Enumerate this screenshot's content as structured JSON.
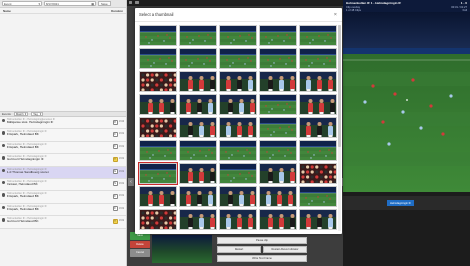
{
  "filterbar": {
    "event_dropdown": "Event",
    "date_value": "8/17/2021",
    "go_button": "Save"
  },
  "left_panel": {
    "col_header_left": "Name",
    "col_header_right": "Duration",
    "toolbar": {
      "label": "Events",
      "select_a": "Match",
      "select_b": "Tag"
    },
    "events": [
      {
        "meta": "Holmenkollen IF • Helmdagningtjenesten IF",
        "title": "Målsjanse skot. Helmdagningin IF",
        "badge": "8",
        "badge_color": "white",
        "num": "3:34",
        "selected": false
      },
      {
        "meta": "Holmenkollen IF • Helmdagningin IF",
        "title": "Frispark, Helmdaud BK",
        "badge": "F",
        "badge_color": "white",
        "num": "3:31",
        "selected": false
      },
      {
        "meta": "Holmenkollen IF • Helmdagningin IF",
        "title": "Frispark, Helmdaud BK",
        "badge": "F",
        "badge_color": "white",
        "num": "3:31",
        "selected": false
      },
      {
        "meta": "Holmenkollen IF • Helmdagningin IF",
        "title": "Gult kort Helmdagningin IF",
        "badge": "Y",
        "badge_color": "yellow",
        "num": "3:31",
        "selected": false
      },
      {
        "meta": "Holmenkollen IF • Helmdagningin IF",
        "title": "1-0 Thomas Sandboerg scoret",
        "badge": "G",
        "badge_color": "white",
        "num": "3:31",
        "selected": true
      },
      {
        "meta": "Holmenkollen IF • Helmdagningin IF",
        "title": "Innkast, Helmdaud BK",
        "badge": "S",
        "badge_color": "white",
        "num": "3:31",
        "selected": false
      },
      {
        "meta": "Holmenkollen IF • Helmdagningin IF",
        "title": "Frispark, Helmdaud BK",
        "badge": "F",
        "badge_color": "white",
        "num": "3:31",
        "selected": false
      },
      {
        "meta": "Holmenkollen IF • Helmdagningin IF",
        "title": "Frispark, Helmdaud BK",
        "badge": "F",
        "badge_color": "white",
        "num": "3:31",
        "selected": false
      },
      {
        "meta": "Holmenkollen IF • Helmdagningin IF",
        "title": "Gult kort Helmdaud BK",
        "badge": "Y",
        "badge_color": "yellow",
        "num": "3:31",
        "selected": false
      }
    ]
  },
  "modal": {
    "title": "Select a thumbnail",
    "close": "×"
  },
  "bottom": {
    "btn_green": "Save",
    "btn_red": "Delete",
    "btn_gray": "Cancel",
    "row1": "Pause clip",
    "row2_left": "Restart",
    "row2_right": "Restart Above Indicator",
    "row3": "Write Text Frame"
  },
  "right_panel": {
    "header_title": "Holmenkollen IF 1 - Helmdagningin IF",
    "header_score": "1 - 0",
    "row2_left": "Clip overlay",
    "row2_right": "00:31 / 01:27",
    "row3_left": "1 of 48 Clips",
    "row3_right": "Full",
    "tag": "Helmdagningin IF"
  },
  "colors": {
    "selected_row": "#d9d6f3",
    "accent_blue": "#1f6dc5",
    "modal_selected_outline": "#c82a2a",
    "green_button": "#3f9a47",
    "red_button": "#c4443a"
  }
}
